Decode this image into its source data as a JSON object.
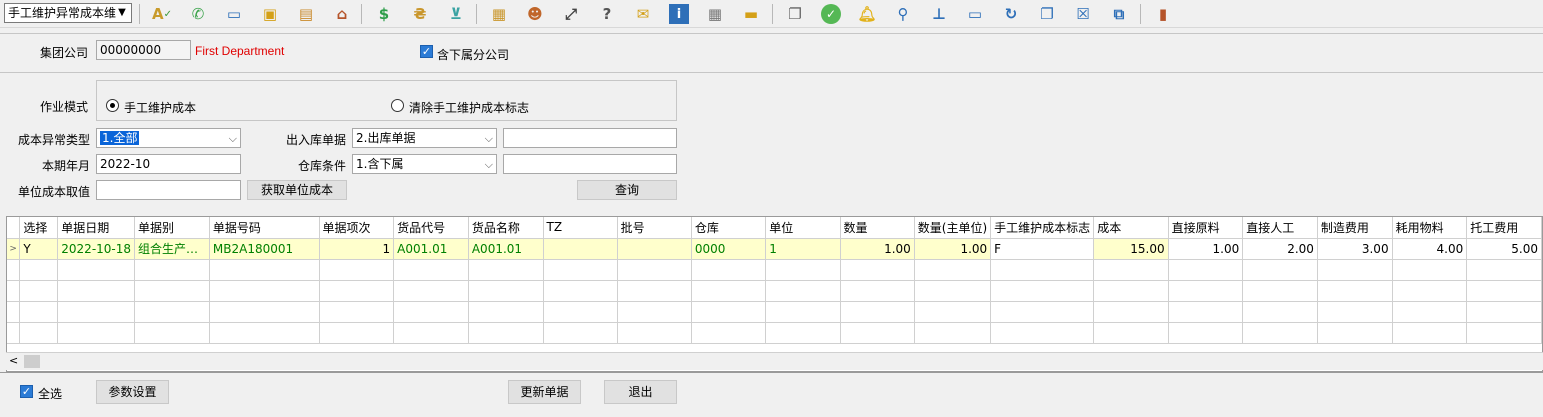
{
  "toolbar": {
    "module_select": "手工维护异常成本维",
    "icons": [
      "spellcheck-icon",
      "phone-icon",
      "computer-icon",
      "lock-icon",
      "briefcase-icon",
      "home-icon",
      "dollar-icon",
      "money-bag-icon",
      "cart-icon",
      "clipboard-icon",
      "users-icon",
      "link-icon",
      "help-icon",
      "mail-icon",
      "info-icon",
      "calculator-icon",
      "folder-icon",
      "copy-icon",
      "check-icon",
      "bell-icon",
      "search-icon",
      "org-chart-icon",
      "monitor-icon",
      "refresh-icon",
      "window-icon",
      "close-icon",
      "restore-icon",
      "exit-door-icon"
    ]
  },
  "company": {
    "label": "集团公司",
    "code": "00000000",
    "name": "First Department",
    "include_sub_label": "含下属分公司",
    "include_sub_checked": true
  },
  "form": {
    "mode_label": "作业模式",
    "mode_option1": "手工维护成本",
    "mode_option2": "清除手工维护成本标志",
    "type_label": "成本异常类型",
    "type_value": "1.全部",
    "doc_label": "出入库单据",
    "doc_value": "2.出库单据",
    "doc_extra": "",
    "period_label": "本期年月",
    "period_value": "2022-10",
    "wh_label": "仓库条件",
    "wh_value": "1.含下属",
    "wh_extra": "",
    "unit_cost_label": "单位成本取值",
    "unit_cost_value": "",
    "get_unit_cost_btn": "获取单位成本",
    "query_btn": "查询"
  },
  "grid": {
    "columns": [
      "选择",
      "单据日期",
      "单据别",
      "单据号码",
      "单据项次",
      "货品代号",
      "货品名称",
      "TZ",
      "批号",
      "仓库",
      "单位",
      "数量",
      "数量(主单位)",
      "手工维护成本标志",
      "成本",
      "直接原料",
      "直接人工",
      "制造费用",
      "耗用物料",
      "托工费用"
    ],
    "rows": [
      [
        "Y",
        "2022-10-18",
        "组合生产…",
        "MB2A180001",
        "1",
        "A001.01",
        "A001.01",
        "",
        "",
        "0000",
        "1",
        "1.00",
        "1.00",
        "F",
        "15.00",
        "1.00",
        "2.00",
        "3.00",
        "4.00",
        "5.00"
      ]
    ]
  },
  "footer": {
    "select_all_label": "全选",
    "select_all_checked": true,
    "params_btn": "参数设置",
    "update_btn": "更新单据",
    "exit_btn": "退出"
  }
}
